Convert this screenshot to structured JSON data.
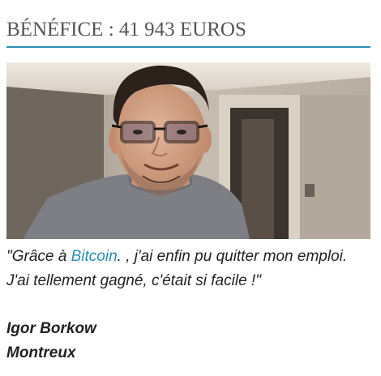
{
  "testimonial": {
    "heading": "BÉNÉFICE : 41 943 EUROS",
    "photo_icon": "portrait-photo",
    "quote_before": "\"Grâce à ",
    "quote_link": "Bitcoin",
    "quote_after": ". , j'ai enfin pu quitter mon emploi. J'ai tellement gagné, c'était si facile !\"",
    "author_name": "Igor Borkow",
    "author_city": "Montreux"
  },
  "colors": {
    "accent": "#2a8db1",
    "heading_text": "#555555",
    "body_text": "#222222"
  }
}
